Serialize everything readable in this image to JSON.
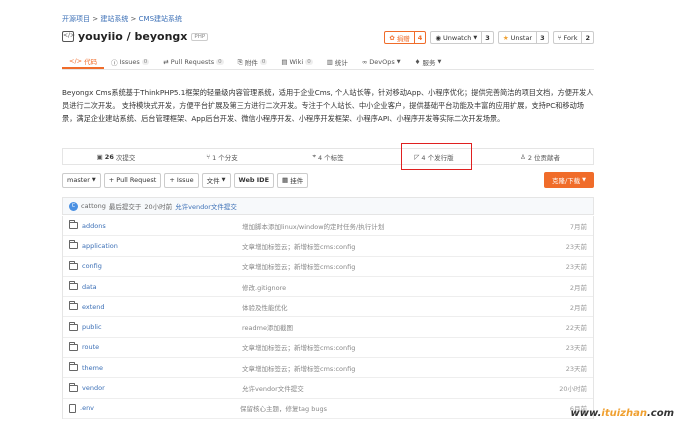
{
  "breadcrumb": [
    "开源项目",
    "建站系统",
    "CMS建站系统"
  ],
  "repo": {
    "owner": "youyiio",
    "name": "beyongx",
    "full": "youyiio / beyongx",
    "lang": "PHP"
  },
  "actions": {
    "donate": {
      "label": "捐赠",
      "count": "4"
    },
    "unwatch": {
      "label": "Unwatch",
      "count": "3"
    },
    "unstar": {
      "label": "Unstar",
      "count": "3"
    },
    "fork": {
      "label": "Fork",
      "count": "2"
    }
  },
  "tabs": [
    {
      "label": "代码",
      "icon": "code-icon"
    },
    {
      "label": "Issues",
      "count": "0"
    },
    {
      "label": "Pull Requests",
      "count": "0"
    },
    {
      "label": "附件",
      "count": "0"
    },
    {
      "label": "Wiki",
      "count": "0"
    },
    {
      "label": "统计"
    },
    {
      "label": "DevOps"
    },
    {
      "label": "服务"
    }
  ],
  "description": "Beyongx Cms系统基于ThinkPHP5.1框架的轻量级内容管理系统，适用于企业Cms, 个人站长等，针对移动App、小程序优化；提供完善简洁的项目文档，方便开发人员进行二次开发。 支持模块式开发，方便平台扩展及第三方进行二次开发。专注于个人站长、中小企业客户，提供基础平台功能及丰富的应用扩展，支持PC和移动场景，满足企业建站系统、后台管理框架、App后台开发、微信小程序开发、小程序开发框架、小程序API、小程序开发等实际二次开发场景。",
  "stats": {
    "commits": {
      "num": "26",
      "label": "次提交"
    },
    "branches": {
      "text": "1 个分支"
    },
    "tags": {
      "text": "4 个标签"
    },
    "releases": {
      "text": "4 个发行版"
    },
    "contributors": {
      "text": "2 位贡献者"
    }
  },
  "toolbar": {
    "branch": "master",
    "pr": "+ Pull Request",
    "issue": "+ Issue",
    "file": "文件",
    "webide": "Web IDE",
    "ward": "挂件",
    "download": "克隆/下载"
  },
  "commit": {
    "avatar": "C",
    "author": "cattong",
    "prefix": "最后提交于",
    "time": "20小时前",
    "message": "允许vendor文件提交"
  },
  "files": [
    {
      "name": "addons",
      "type": "folder",
      "msg": "增加脚本添加linux/window的定时任务/执行计划",
      "time": "7月前"
    },
    {
      "name": "application",
      "type": "folder",
      "msg": "文章增加标签云；新增标签cms:config",
      "time": "23天前"
    },
    {
      "name": "config",
      "type": "folder",
      "msg": "文章增加标签云；新增标签cms:config",
      "time": "23天前"
    },
    {
      "name": "data",
      "type": "folder",
      "msg": "修改.gitignore",
      "time": "2月前"
    },
    {
      "name": "extend",
      "type": "folder",
      "msg": "体验及性能优化",
      "time": "2月前"
    },
    {
      "name": "public",
      "type": "folder",
      "msg": "readme添加截图",
      "time": "22天前"
    },
    {
      "name": "route",
      "type": "folder",
      "msg": "文章增加标签云；新增标签cms:config",
      "time": "23天前"
    },
    {
      "name": "theme",
      "type": "folder",
      "msg": "文章增加标签云；新增标签cms:config",
      "time": "23天前"
    },
    {
      "name": "vendor",
      "type": "folder",
      "msg": "允许vendor文件提交",
      "time": "20小时前"
    },
    {
      "name": ".env",
      "type": "file",
      "msg": "保留核心主题，修复tag bugs",
      "time": "6月前"
    }
  ],
  "watermark": {
    "brand": "www.",
    "name": "ituizhan",
    "suffix": ".com"
  },
  "colors": {
    "accent": "#f06c2a",
    "link": "#3b6fb6",
    "highlight": "#e02020"
  }
}
